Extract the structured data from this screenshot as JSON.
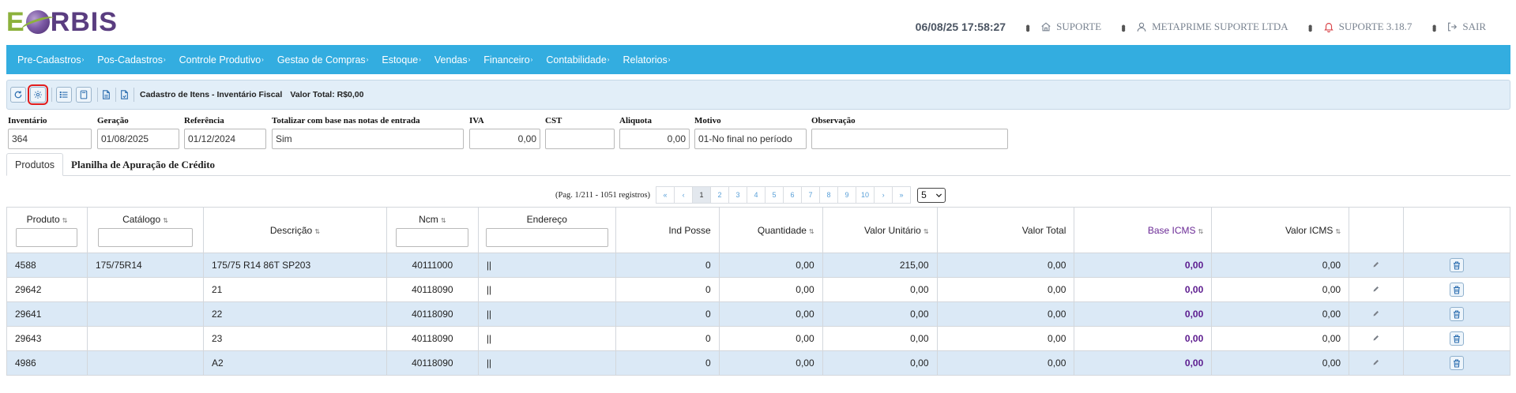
{
  "logo": {
    "letter_e": "E",
    "letters_rbis": "RBIS"
  },
  "header": {
    "datetime": "06/08/25 17:58:27",
    "support_label": "SUPORTE",
    "company": "METAPRIME SUPORTE LTDA",
    "version": "SUPORTE 3.18.7",
    "exit_label": "SAIR"
  },
  "menu": {
    "items": [
      {
        "label": "Pre-Cadastros"
      },
      {
        "label": "Pos-Cadastros"
      },
      {
        "label": "Controle Produtivo"
      },
      {
        "label": "Gestao de Compras"
      },
      {
        "label": "Estoque"
      },
      {
        "label": "Vendas"
      },
      {
        "label": "Financeiro"
      },
      {
        "label": "Contabilidade"
      },
      {
        "label": "Relatorios"
      }
    ],
    "caret": "›"
  },
  "toolbar": {
    "title": "Cadastro de Itens - Inventário Fiscal",
    "total": "Valor Total: R$0,00"
  },
  "form": {
    "inventario": {
      "label": "Inventário",
      "value": "364"
    },
    "geracao": {
      "label": "Geração",
      "value": "01/08/2025"
    },
    "referencia": {
      "label": "Referência",
      "value": "01/12/2024"
    },
    "totalizar": {
      "label": "Totalizar com base nas notas de entrada",
      "value": "Sim"
    },
    "iva": {
      "label": "IVA",
      "value": "0,00"
    },
    "cst": {
      "label": "CST",
      "value": ""
    },
    "aliquota": {
      "label": "Aliquota",
      "value": "0,00"
    },
    "motivo": {
      "label": "Motivo",
      "value": "01-No final no período"
    },
    "observacao": {
      "label": "Observação",
      "value": ""
    }
  },
  "tabs": [
    {
      "label": "Produtos"
    },
    {
      "label": "Planilha de Apuração de Crédito"
    }
  ],
  "pagination": {
    "info": "(Pag. 1/211 - 1051 registros)",
    "first": "«",
    "prev": "‹",
    "pages": [
      "1",
      "2",
      "3",
      "4",
      "5",
      "6",
      "7",
      "8",
      "9",
      "10"
    ],
    "next": "›",
    "last": "»",
    "page_size": "5"
  },
  "table": {
    "columns": {
      "produto": "Produto",
      "catalogo": "Catálogo",
      "descricao": "Descrição",
      "ncm": "Ncm",
      "endereco": "Endereço",
      "ind_posse": "Ind Posse",
      "quantidade": "Quantidade",
      "valor_unitario": "Valor Unitário",
      "valor_total": "Valor Total",
      "base_icms": "Base ICMS",
      "valor_icms": "Valor ICMS"
    },
    "sort_glyph": "⇅",
    "rows": [
      {
        "produto": "4588",
        "catalogo": "175/75R14",
        "descricao": "175/75 R14 86T SP203",
        "ncm": "40111000",
        "endereco": "||",
        "ind_posse": "0",
        "quantidade": "0,00",
        "valor_unitario": "215,00",
        "valor_total": "0,00",
        "base_icms": "0,00",
        "valor_icms": "0,00"
      },
      {
        "produto": "29642",
        "catalogo": "",
        "descricao": "21",
        "ncm": "40118090",
        "endereco": "||",
        "ind_posse": "0",
        "quantidade": "0,00",
        "valor_unitario": "0,00",
        "valor_total": "0,00",
        "base_icms": "0,00",
        "valor_icms": "0,00"
      },
      {
        "produto": "29641",
        "catalogo": "",
        "descricao": "22",
        "ncm": "40118090",
        "endereco": "||",
        "ind_posse": "0",
        "quantidade": "0,00",
        "valor_unitario": "0,00",
        "valor_total": "0,00",
        "base_icms": "0,00",
        "valor_icms": "0,00"
      },
      {
        "produto": "29643",
        "catalogo": "",
        "descricao": "23",
        "ncm": "40118090",
        "endereco": "||",
        "ind_posse": "0",
        "quantidade": "0,00",
        "valor_unitario": "0,00",
        "valor_total": "0,00",
        "base_icms": "0,00",
        "valor_icms": "0,00"
      },
      {
        "produto": "4986",
        "catalogo": "",
        "descricao": "A2",
        "ncm": "40118090",
        "endereco": "||",
        "ind_posse": "0",
        "quantidade": "0,00",
        "valor_unitario": "0,00",
        "valor_total": "0,00",
        "base_icms": "0,00",
        "valor_icms": "0,00"
      }
    ]
  },
  "colors": {
    "menu_bg": "#33ade0",
    "toolbar_bg": "#e2eef8",
    "row_alt": "#dbe9f6",
    "base_icms": "#5b1a8e",
    "highlight": "#e21c1c"
  },
  "icons": {
    "refresh": "refresh-icon",
    "settings": "gear-icon",
    "list": "list-icon",
    "calculator": "calculator-icon",
    "doc1": "document-icon",
    "doc2": "document-icon",
    "home": "home-icon",
    "user": "user-icon",
    "bell": "bell-icon",
    "exit": "exit-icon",
    "edit": "pencil-icon",
    "trash": "trash-icon"
  }
}
